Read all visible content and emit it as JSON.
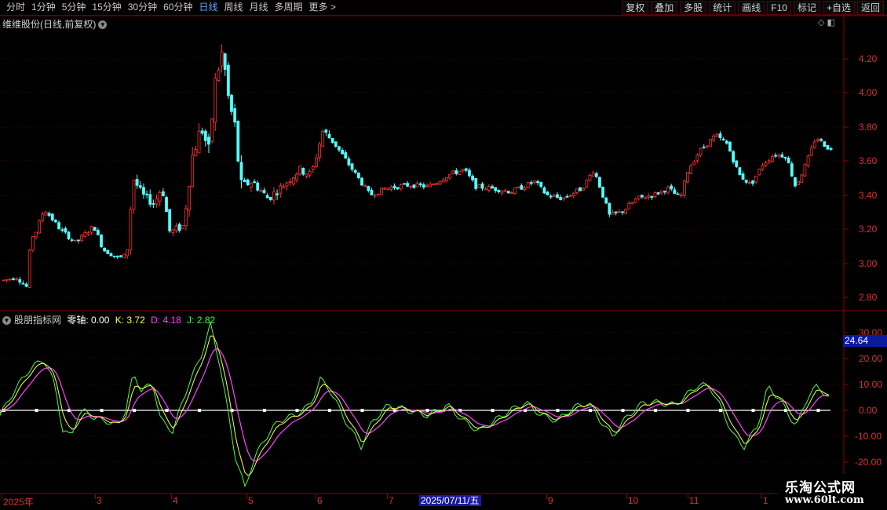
{
  "toolbar": {
    "periods": [
      "分时",
      "1分钟",
      "5分钟",
      "15分钟",
      "30分钟",
      "60分钟",
      "日线",
      "周线",
      "月线",
      "多周期",
      "更多 >"
    ],
    "active_period": "日线",
    "buttons": [
      "复权",
      "叠加",
      "多股",
      "统计",
      "画线",
      "F10",
      "标记",
      "+自选",
      "返回"
    ]
  },
  "main_panel": {
    "title": "维维股份(日线,前复权)",
    "y_ticks": [
      "4.20",
      "4.00",
      "3.80",
      "3.60",
      "3.40",
      "3.20",
      "3.00",
      "2.80"
    ],
    "colors": {
      "up": "#ff3232",
      "down": "#54ffff",
      "frame": "#8b0000"
    }
  },
  "indicator_panel": {
    "name": "股朋指标网",
    "zero_label": "零轴: 0.00",
    "k_label": "K: 3.72",
    "d_label": "D: 4.18",
    "j_label": "J: 2.82",
    "y_ticks": [
      "30.00",
      "20.00",
      "10.00",
      "0.00",
      "-10.00",
      "-20.00"
    ],
    "current_value": "24.64",
    "colors": {
      "k": "#ffff55",
      "d": "#ff44ff",
      "j": "#44ff44",
      "zero": "#ffffff",
      "name": "#cccccc"
    }
  },
  "x_axis": {
    "labels": [
      "2025年",
      "3",
      "4",
      "5",
      "6",
      "7",
      "9",
      "10",
      "11",
      "1"
    ],
    "cursor_date": "2025/07/11/五"
  },
  "watermark": {
    "title": "乐淘公式网",
    "url": "www.60lt.com"
  },
  "chart_data": {
    "type": "candlestick+line",
    "price_range": [
      2.76,
      4.44
    ],
    "indicator_range": [
      -24,
      34
    ],
    "k_line_series": "KDJ-style indicator with K, D, J lines oscillating around zero axis"
  }
}
